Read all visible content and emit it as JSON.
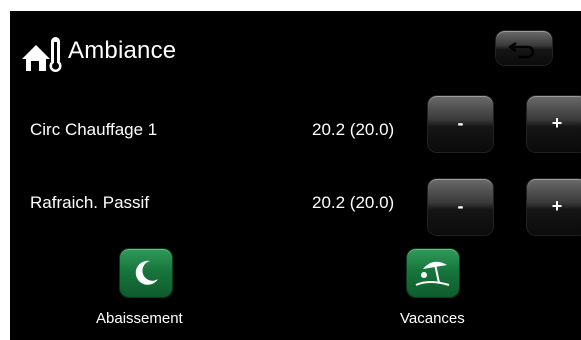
{
  "header": {
    "title": "Ambiance",
    "home_icon": "home-thermometer-icon",
    "back_icon": "back-arrow-icon"
  },
  "rows": [
    {
      "label": "Circ Chauffage 1",
      "value": "20.2 (20.0)",
      "minus": "-",
      "plus": "+"
    },
    {
      "label": "Rafraich. Passif",
      "value": "20.2 (20.0)",
      "minus": "-",
      "plus": "+"
    }
  ],
  "actions": [
    {
      "label": "Abaissement",
      "icon": "moon-icon"
    },
    {
      "label": "Vacances",
      "icon": "beach-umbrella-icon"
    }
  ],
  "colors": {
    "background": "#000000",
    "text": "#ffffff",
    "action_green": "#17763c",
    "button_dark": "#2a2a2a"
  }
}
